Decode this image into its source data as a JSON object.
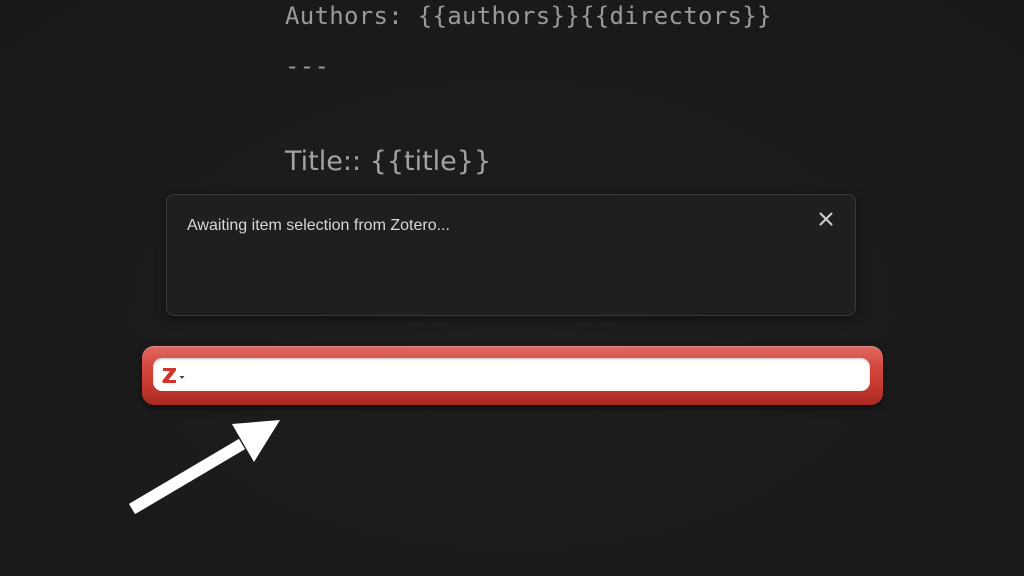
{
  "editor": {
    "authors_line": "Authors: {{authors}}{{directors}}",
    "separator_line": "---",
    "title_line": "Title:: {{title}}"
  },
  "notice": {
    "message": "Awaiting item selection from Zotero...",
    "close_icon": "close-icon"
  },
  "zotero_search": {
    "logo": "zotero-z-logo",
    "value": "",
    "placeholder": "",
    "bar_color": "#c73a31"
  },
  "annotation": {
    "arrow_icon": "arrow-pointer",
    "arrow_color": "#ffffff"
  }
}
